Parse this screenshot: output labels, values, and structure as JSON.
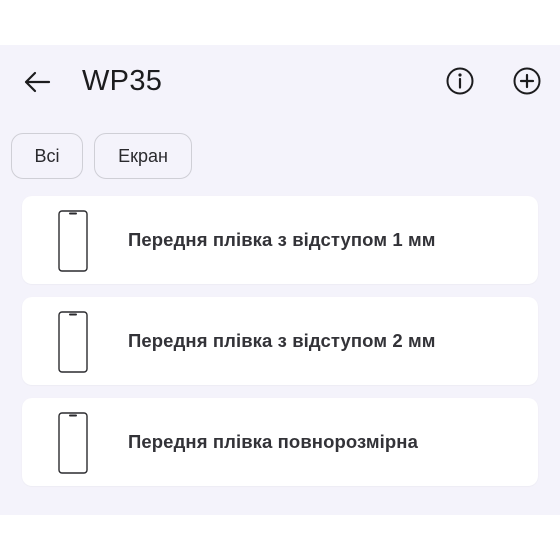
{
  "header": {
    "title": "WP35",
    "back_icon": "arrow-left-icon",
    "info_icon": "info-circle-icon",
    "add_icon": "plus-circle-icon"
  },
  "filters": [
    {
      "label": "Всі"
    },
    {
      "label": "Екран"
    }
  ],
  "items": [
    {
      "label": "Передня плівка з відступом 1 мм",
      "icon": "phone-outline-icon"
    },
    {
      "label": "Передня плівка з відступом 2 мм",
      "icon": "phone-outline-icon"
    },
    {
      "label": "Передня плівка повнорозмірна",
      "icon": "phone-outline-icon"
    }
  ],
  "colors": {
    "background": "#f4f3fb",
    "card": "#ffffff",
    "text": "#1c1c1e",
    "chip_border": "#cfcfd6"
  }
}
